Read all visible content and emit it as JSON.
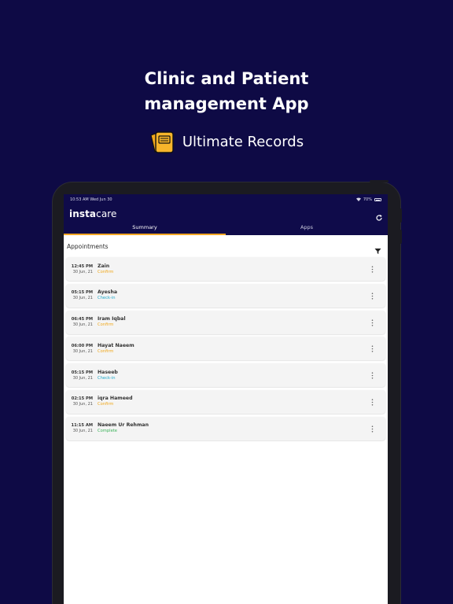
{
  "promo": {
    "title_line1": "Clinic and Patient",
    "title_line2": "management App",
    "subtitle": "Ultimate Records",
    "icon": "records-folder-icon"
  },
  "device": {
    "status_time": "10:53 AM  Wed Jun 30",
    "battery_text": "70%"
  },
  "app": {
    "brand_bold": "insta",
    "brand_light": "care",
    "tabs": [
      {
        "label": "Summary",
        "active": true
      },
      {
        "label": "Apps",
        "active": false
      }
    ],
    "section_title": "Appointments"
  },
  "appointments": [
    {
      "time": "12:45 PM",
      "date": "30 Jun, 21",
      "name": "Zain",
      "status": "Confirm",
      "status_color": "#f0a81c"
    },
    {
      "time": "05:15 PM",
      "date": "30 Jun, 21",
      "name": "Ayesha",
      "status": "Check-in",
      "status_color": "#1fa8c9"
    },
    {
      "time": "06:45 PM",
      "date": "30 Jun, 21",
      "name": "Iram Iqbal",
      "status": "Confirm",
      "status_color": "#f0a81c"
    },
    {
      "time": "06:00 PM",
      "date": "30 Jun, 21",
      "name": "Hayat Naeem",
      "status": "Confirm",
      "status_color": "#f0a81c"
    },
    {
      "time": "05:15 PM",
      "date": "30 Jun, 21",
      "name": "Haseeb",
      "status": "Check-in",
      "status_color": "#1fa8c9"
    },
    {
      "time": "02:15 PM",
      "date": "30 Jun, 21",
      "name": "iqra Hameed",
      "status": "Confirm",
      "status_color": "#f0a81c"
    },
    {
      "time": "11:15 AM",
      "date": "30 Jun, 21",
      "name": "Naeem Ur Rehman",
      "status": "Complete",
      "status_color": "#3cb35a"
    }
  ],
  "colors": {
    "background": "#0e0a45",
    "appbar": "#0f0b4a",
    "tab_indicator": "#f5a623"
  }
}
